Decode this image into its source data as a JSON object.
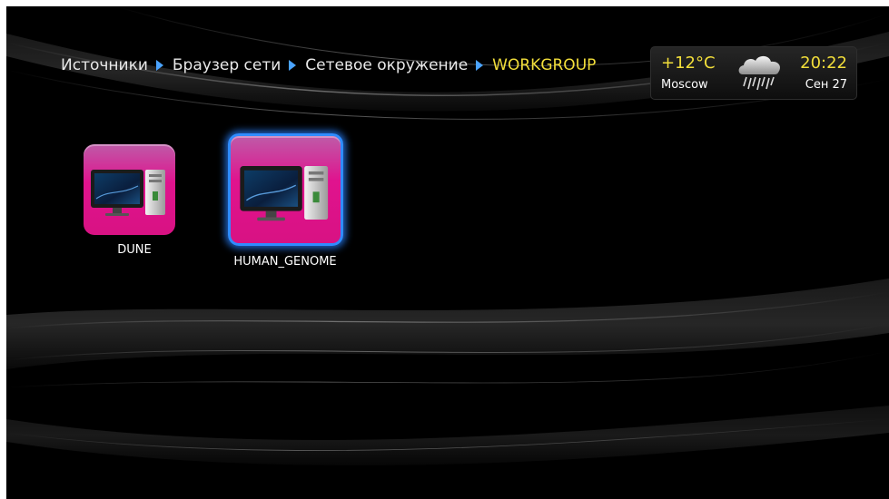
{
  "breadcrumb": {
    "items": [
      "Источники",
      "Браузер сети",
      "Сетевое окружение",
      "WORKGROUP"
    ]
  },
  "widget": {
    "temperature": "+12°C",
    "city": "Moscow",
    "time": "20:22",
    "date": "Сен 27",
    "weather_icon": "rain-cloud-icon"
  },
  "items": [
    {
      "label": "DUNE",
      "icon": "computer-icon",
      "selected": false
    },
    {
      "label": "HUMAN_GENOME",
      "icon": "computer-icon",
      "selected": true
    }
  ],
  "colors": {
    "accent_text": "#f2de3a",
    "tile_pink": "#e0138e",
    "selection_blue": "#2f8cff",
    "breadcrumb_arrow": "#4aa3ff"
  }
}
